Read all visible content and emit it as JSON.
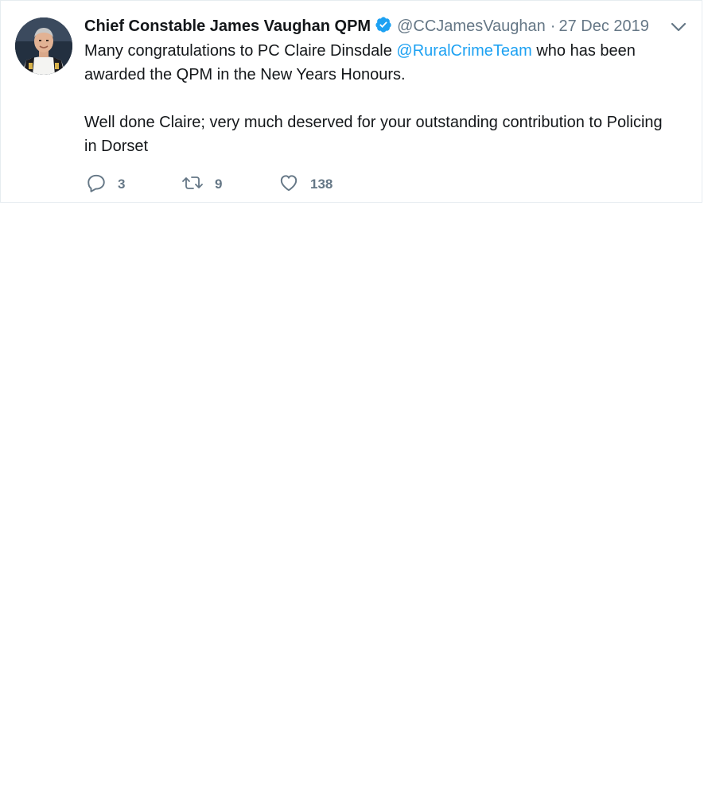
{
  "tweet": {
    "author_name": "Chief Constable James Vaughan QPM",
    "handle": "@CCJamesVaughan",
    "separator": "·",
    "date": "27 Dec 2019",
    "text_part1": "Many congratulations to PC Claire Dinsdale ",
    "mention": "@RuralCrimeTeam",
    "text_part2": " who has been awarded the QPM in the New Years Honours.",
    "text_paragraph2": "Well done Claire; very much deserved for your outstanding contribution to Policing in Dorset",
    "replies": "3",
    "retweets": "9",
    "likes": "138"
  },
  "icons": {
    "verified": "verified-badge-icon",
    "caret": "chevron-down-icon",
    "reply": "reply-icon",
    "retweet": "retweet-icon",
    "like": "heart-icon"
  },
  "colors": {
    "accent": "#1da1f2",
    "muted": "#657786",
    "text": "#14171a",
    "border": "#e6ecf0"
  }
}
